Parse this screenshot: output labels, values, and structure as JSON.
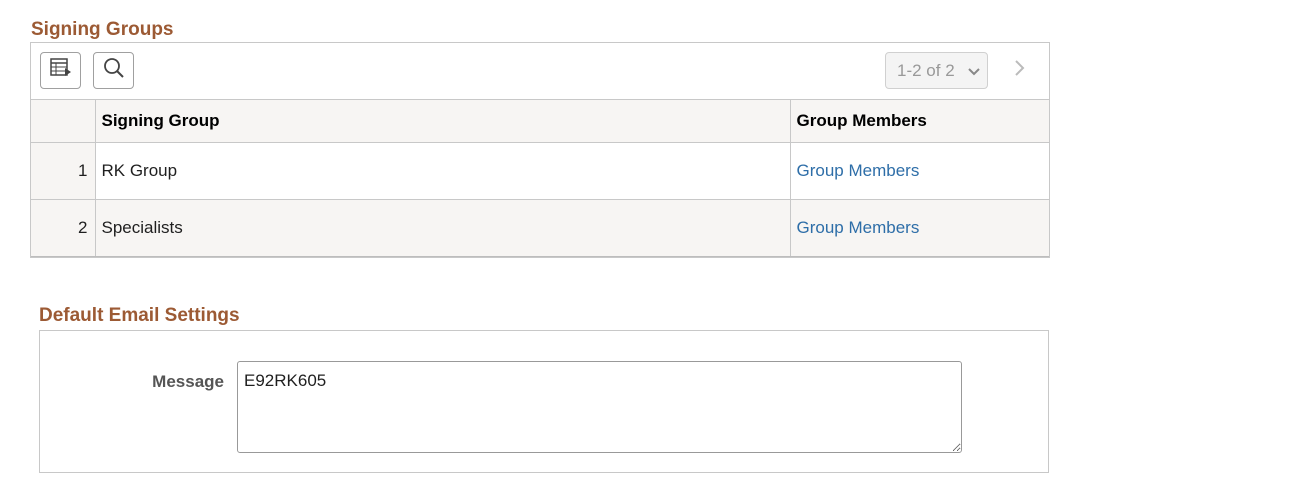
{
  "signing_groups": {
    "title": "Signing Groups",
    "pager_label": "1-2 of 2",
    "columns": [
      "",
      "Signing Group",
      "Group Members"
    ],
    "rows": [
      {
        "num": "1",
        "group": "RK Group",
        "members_link": "Group Members"
      },
      {
        "num": "2",
        "group": "Specialists",
        "members_link": "Group Members"
      }
    ]
  },
  "default_email": {
    "title": "Default Email Settings",
    "message_label": "Message",
    "message_value": "E92RK605"
  },
  "colors": {
    "section_title": "#9c5a34",
    "link": "#2e6ea8"
  }
}
